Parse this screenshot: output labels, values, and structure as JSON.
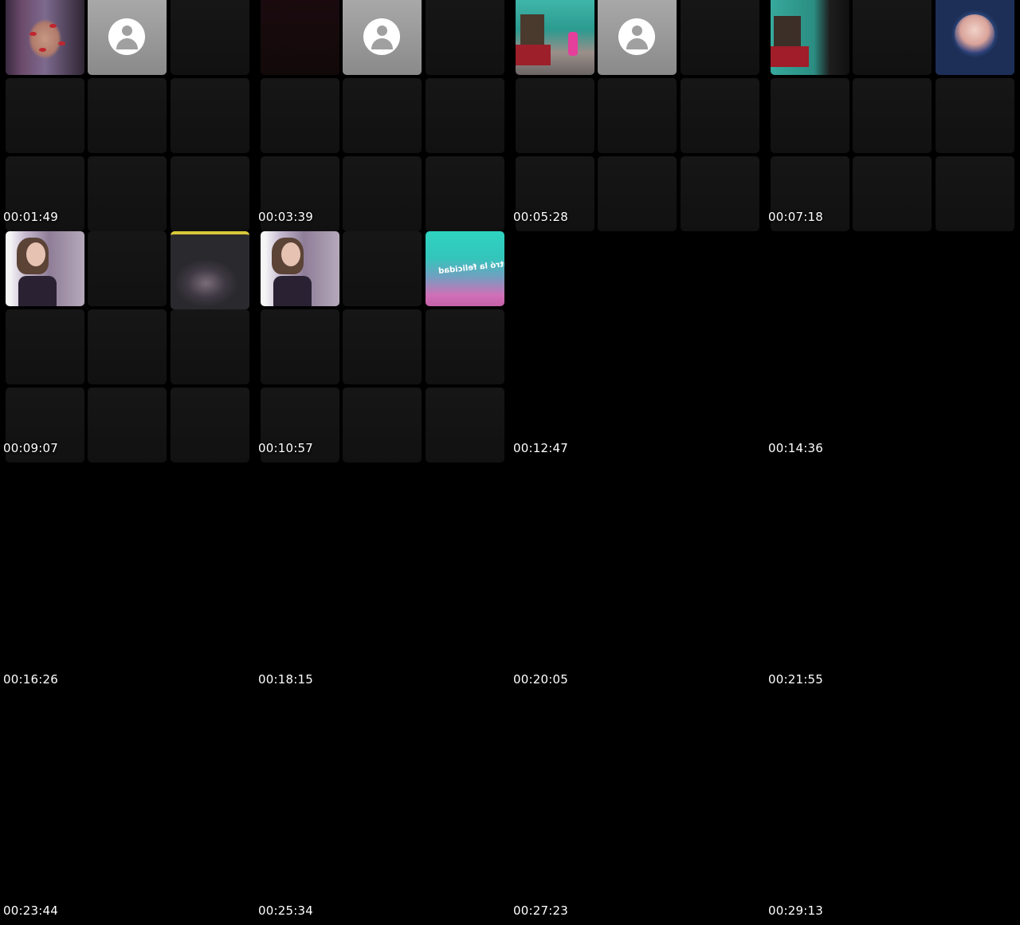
{
  "timestamps": [
    "00:01:49",
    "00:03:39",
    "00:05:28",
    "00:07:18",
    "00:09:07",
    "00:10:57",
    "00:12:47",
    "00:14:36",
    "00:16:26",
    "00:18:15",
    "00:20:05",
    "00:21:55",
    "00:23:44",
    "00:25:34",
    "00:27:23",
    "00:29:13"
  ],
  "tiles": {
    "f1": [
      "face-lips",
      "default-avatar",
      "empty"
    ],
    "f2": [
      "dark",
      "default-avatar",
      "empty"
    ],
    "f3": [
      "room-kid",
      "default-avatar",
      "empty"
    ],
    "f4": [
      "room",
      "empty",
      "portrait"
    ],
    "f5": [
      "selfie",
      "empty",
      "blurred"
    ],
    "f6": [
      "selfie",
      "empty",
      "text-caption"
    ]
  },
  "captions": {
    "f6_tile3": "ontró la felicidad"
  },
  "icons": {
    "default_avatar": "person-placeholder-icon"
  }
}
